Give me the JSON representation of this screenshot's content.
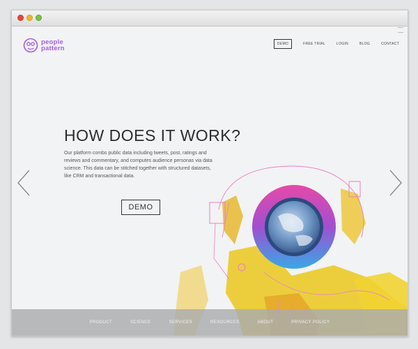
{
  "logo": {
    "line1": "people",
    "line2": "pattern"
  },
  "nav": [
    {
      "label": "DEMO"
    },
    {
      "label": "FREE TRIAL"
    },
    {
      "label": "LOGIN"
    },
    {
      "label": "BLOG"
    },
    {
      "label": "CONTACT"
    }
  ],
  "hero": {
    "title": "HOW DOES IT WORK?",
    "text": "Our platform combs public data including tweets, post, ratings and reviews and commentary, and computes audience personas via data science. This data can be stitched together with structured datasets, like CRM and transactional data.",
    "button": "DEMO"
  },
  "footer": [
    {
      "label": "PRODUCT"
    },
    {
      "label": "SCIENCE"
    },
    {
      "label": "SERVICES"
    },
    {
      "label": "RESOURCES"
    },
    {
      "label": "ABOUT"
    },
    {
      "label": "PRIVACY POLICY"
    }
  ],
  "colors": {
    "accent": "#a45de0",
    "text": "#2d2d2d",
    "footer_bg": "#aaacaf"
  },
  "icons": {
    "left_arrow": "chevron-left-icon",
    "right_arrow": "chevron-right-icon"
  }
}
